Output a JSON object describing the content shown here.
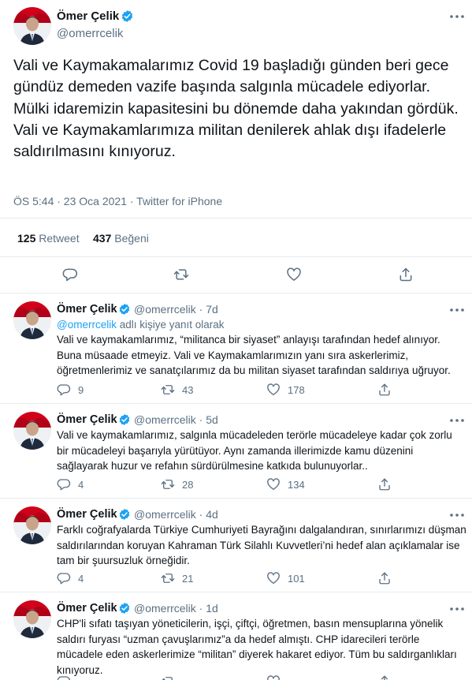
{
  "main_tweet": {
    "author_name": "Ömer Çelik",
    "author_handle": "@omerrcelik",
    "text_paragraphs": [
      "Vali ve Kaymakamalarımız Covid 19 başladığı günden beri gece gündüz demeden vazife başında salgınla mücadele ediyorlar. Mülki idaremizin kapasitesini bu dönemde daha yakından gördük.",
      "Vali ve Kaymakamlarımıza militan denilerek ahlak dışı ifadelerle saldırılmasını kınıyoruz."
    ],
    "meta": "ÖS 5:44 · 23 Oca 2021 · Twitter for iPhone",
    "retweet_count": "125",
    "retweet_label": "Retweet",
    "like_count": "437",
    "like_label": "Beğeni"
  },
  "replies": [
    {
      "author_name": "Ömer Çelik",
      "author_handle": "@omerrcelik · 7d",
      "reply_to_handle": "@omerrcelik",
      "reply_to_suffix": " adlı kişiye yanıt olarak",
      "text": "Vali ve kaymakamlarımız, “militanca bir siyaset” anlayışı tarafından hedef alınıyor. Buna müsaade etmeyiz. Vali ve Kaymakamlarımızın yanı sıra askerlerimiz, öğretmenlerimiz ve sanatçılarımız da bu militan siyaset tarafından saldırıya uğruyor.",
      "reply_count": "9",
      "retweet_count": "43",
      "like_count": "178"
    },
    {
      "author_name": "Ömer Çelik",
      "author_handle": "@omerrcelik · 5d",
      "text": "Vali ve kaymakamlarımız, salgınla mücadeleden terörle mücadeleye kadar çok zorlu bir mücadeleyi başarıyla yürütüyor. Aynı zamanda illerimizde kamu düzenini sağlayarak huzur ve refahın sürdürülmesine katkıda bulunuyorlar..",
      "reply_count": "4",
      "retweet_count": "28",
      "like_count": "134"
    },
    {
      "author_name": "Ömer Çelik",
      "author_handle": "@omerrcelik · 4d",
      "text": "Farklı coğrafyalarda Türkiye Cumhuriyeti Bayrağını dalgalandıran, sınırlarımızı düşman saldırılarından koruyan Kahraman Türk Silahlı Kuvvetleri’ni hedef alan açıklamalar ise tam bir şuursuzluk örneğidir.",
      "reply_count": "4",
      "retweet_count": "21",
      "like_count": "101"
    },
    {
      "author_name": "Ömer Çelik",
      "author_handle": "@omerrcelik · 1d",
      "text": "CHP'li sıfatı taşıyan yöneticilerin, işçi, çiftçi, öğretmen, basın mensuplarına yönelik saldırı furyası “uzman çavuşlarımız”a da hedef almıştı. CHP idarecileri terörle mücadele eden askerlerimize “militan” diyerek hakaret ediyor.  Tüm bu saldırganlıkları kınıyoruz."
    }
  ],
  "colors": {
    "accent": "#1da1f2",
    "secondary_text": "#5b7083",
    "divider": "#e6ecf0",
    "flag_red": "#d0021b"
  }
}
